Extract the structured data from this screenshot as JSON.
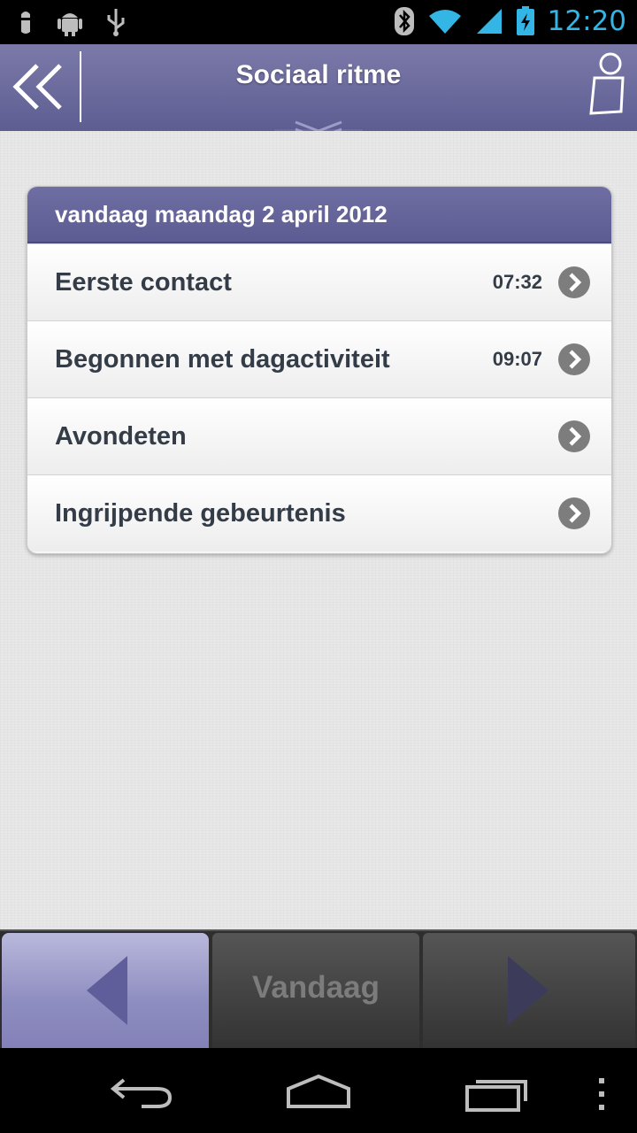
{
  "status_bar": {
    "time": "12:20",
    "icons": [
      "bug-icon",
      "android-icon",
      "usb-icon",
      "bluetooth-icon",
      "wifi-icon",
      "signal-icon",
      "battery-charging-icon"
    ]
  },
  "header": {
    "title": "Sociaal ritme",
    "back_icon": "double-chevron-left-icon",
    "user_icon": "person-icon",
    "pull_tab_icon": "double-chevron-down-icon"
  },
  "card": {
    "date_header": "vandaag maandag 2 april 2012",
    "rows": [
      {
        "label": "Eerste contact",
        "time": "07:32"
      },
      {
        "label": "Begonnen met dagactiviteit",
        "time": "09:07"
      },
      {
        "label": "Avondeten",
        "time": ""
      },
      {
        "label": "Ingrijpende gebeurtenis",
        "time": ""
      }
    ]
  },
  "bottom_nav": {
    "prev_icon": "triangle-left-icon",
    "today_label": "Vandaag",
    "next_icon": "triangle-right-icon"
  },
  "system_nav": {
    "icons": [
      "back-arrow-icon",
      "home-icon",
      "recent-apps-icon",
      "overflow-menu-icon"
    ]
  },
  "colors": {
    "header": "#6b6a9e",
    "status_time": "#33b5e5",
    "row_text": "#333c47"
  }
}
